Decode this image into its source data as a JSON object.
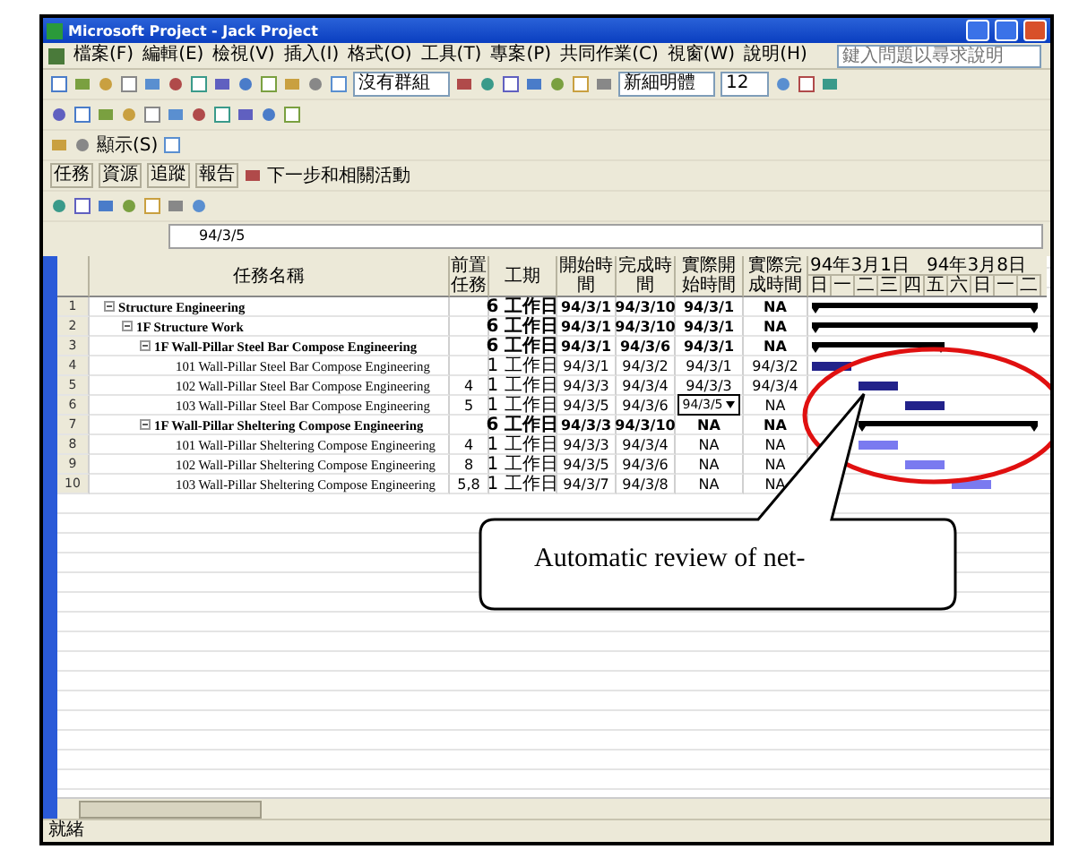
{
  "window": {
    "title": "Microsoft Project - Jack Project"
  },
  "menu": [
    {
      "label": "檔案(F)"
    },
    {
      "label": "編輯(E)"
    },
    {
      "label": "檢視(V)"
    },
    {
      "label": "插入(I)"
    },
    {
      "label": "格式(O)"
    },
    {
      "label": "工具(T)"
    },
    {
      "label": "專案(P)"
    },
    {
      "label": "共同作業(C)"
    },
    {
      "label": "視窗(W)"
    },
    {
      "label": "說明(H)"
    }
  ],
  "help_box": {
    "placeholder": "鍵入問題以尋求說明"
  },
  "toolbars": [
    {
      "items": [
        {
          "kind": "icon"
        },
        {
          "kind": "icon"
        },
        {
          "kind": "icon"
        },
        {
          "kind": "icon"
        },
        {
          "kind": "icon"
        },
        {
          "kind": "icon"
        },
        {
          "kind": "icon"
        },
        {
          "kind": "icon"
        },
        {
          "kind": "icon"
        },
        {
          "kind": "icon"
        },
        {
          "kind": "icon"
        },
        {
          "kind": "icon"
        },
        {
          "kind": "icon"
        },
        {
          "kind": "dropdown",
          "text": "沒有群組"
        },
        {
          "kind": "icon"
        },
        {
          "kind": "icon"
        },
        {
          "kind": "icon"
        },
        {
          "kind": "icon"
        },
        {
          "kind": "icon"
        },
        {
          "kind": "icon"
        },
        {
          "kind": "icon"
        },
        {
          "kind": "dropdown",
          "text": "新細明體"
        },
        {
          "kind": "dropdown",
          "text": "12"
        },
        {
          "kind": "icon"
        },
        {
          "kind": "icon"
        },
        {
          "kind": "icon"
        }
      ]
    },
    {
      "items": [
        {
          "kind": "icon"
        },
        {
          "kind": "icon"
        },
        {
          "kind": "icon"
        },
        {
          "kind": "icon"
        },
        {
          "kind": "icon"
        },
        {
          "kind": "icon"
        },
        {
          "kind": "icon"
        },
        {
          "kind": "icon"
        },
        {
          "kind": "icon"
        },
        {
          "kind": "icon"
        },
        {
          "kind": "icon"
        }
      ]
    },
    {
      "items": [
        {
          "kind": "icon"
        },
        {
          "kind": "icon"
        },
        {
          "kind": "text",
          "text": "顯示(S)"
        },
        {
          "kind": "icon"
        }
      ]
    },
    {
      "items": [
        {
          "kind": "tab",
          "text": "任務"
        },
        {
          "kind": "tab",
          "text": "資源"
        },
        {
          "kind": "tab",
          "text": "追蹤"
        },
        {
          "kind": "tab",
          "text": "報告"
        },
        {
          "kind": "icon"
        },
        {
          "kind": "text",
          "text": "下一步和相關活動"
        }
      ]
    },
    {
      "items": [
        {
          "kind": "icon"
        },
        {
          "kind": "icon"
        },
        {
          "kind": "icon"
        },
        {
          "kind": "icon"
        },
        {
          "kind": "icon"
        },
        {
          "kind": "icon"
        },
        {
          "kind": "icon"
        }
      ]
    }
  ],
  "entry_bar": {
    "value": "94/3/5"
  },
  "table": {
    "columns": [
      {
        "label": "任務名稱"
      },
      {
        "label": "前置任務"
      },
      {
        "label": "工期"
      },
      {
        "label": "開始時間"
      },
      {
        "label": "完成時間"
      },
      {
        "label": "實際開始時間"
      },
      {
        "label": "實際完成時間"
      }
    ],
    "rows": [
      {
        "id": "1",
        "name": "Structure Engineering",
        "duration": "6 工作日",
        "start": "94/3/1",
        "finish": "94/3/10",
        "actual_start": "94/3/1",
        "actual_finish": "NA",
        "summary": true,
        "expanded": true,
        "editing": false,
        "children": [
          {
            "id": "2",
            "name": "1F Structure Work",
            "duration": "6 工作日",
            "start": "94/3/1",
            "finish": "94/3/10",
            "actual_start": "94/3/1",
            "actual_finish": "NA",
            "summary": true,
            "expanded": true,
            "editing": false,
            "children": [
              {
                "id": "3",
                "name": "1F Wall-Pillar Steel Bar Compose Engineering",
                "duration": "6 工作日",
                "start": "94/3/1",
                "finish": "94/3/6",
                "actual_start": "94/3/1",
                "actual_finish": "NA",
                "summary": true,
                "expanded": true,
                "editing": false,
                "children": [
                  {
                    "id": "4",
                    "name": "101 Wall-Pillar Steel Bar Compose Engineering",
                    "duration": "1 工作日",
                    "start": "94/3/1",
                    "finish": "94/3/2",
                    "actual_start": "94/3/1",
                    "actual_finish": "94/3/2",
                    "summary": false,
                    "critical": true,
                    "editing": false
                  },
                  {
                    "id": "5",
                    "name": "102 Wall-Pillar Steel Bar Compose Engineering",
                    "predecessors": "4",
                    "duration": "1 工作日",
                    "start": "94/3/3",
                    "finish": "94/3/4",
                    "actual_start": "94/3/3",
                    "actual_finish": "94/3/4",
                    "summary": false,
                    "critical": true,
                    "editing": false
                  },
                  {
                    "id": "6",
                    "name": "103 Wall-Pillar Steel Bar Compose Engineering",
                    "predecessors": "5",
                    "duration": "1 工作日",
                    "start": "94/3/5",
                    "finish": "94/3/6",
                    "actual_start": "94/3/5",
                    "actual_finish": "NA",
                    "summary": false,
                    "critical": true,
                    "editing": true
                  }
                ]
              },
              {
                "id": "7",
                "name": "1F Wall-Pillar Sheltering Compose Engineering",
                "duration": "6 工作日",
                "start": "94/3/3",
                "finish": "94/3/10",
                "actual_start": "NA",
                "actual_finish": "NA",
                "summary": true,
                "expanded": true,
                "editing": false,
                "children": [
                  {
                    "id": "8",
                    "name": "101 Wall-Pillar Sheltering Compose Engineering",
                    "predecessors": "4",
                    "duration": "1 工作日",
                    "start": "94/3/3",
                    "finish": "94/3/4",
                    "actual_start": "NA",
                    "actual_finish": "NA",
                    "summary": false,
                    "critical": false,
                    "editing": false
                  },
                  {
                    "id": "9",
                    "name": "102 Wall-Pillar Sheltering Compose Engineering",
                    "predecessors": "8",
                    "duration": "1 工作日",
                    "start": "94/3/5",
                    "finish": "94/3/6",
                    "actual_start": "NA",
                    "actual_finish": "NA",
                    "summary": false,
                    "critical": false,
                    "editing": false
                  },
                  {
                    "id": "10",
                    "name": "103 Wall-Pillar Sheltering Compose Engineering",
                    "predecessors": "5,8",
                    "duration": "1 工作日",
                    "start": "94/3/7",
                    "finish": "94/3/8",
                    "actual_start": "NA",
                    "actual_finish": "NA",
                    "summary": false,
                    "critical": false,
                    "editing": false
                  }
                ]
              }
            ]
          }
        ]
      }
    ]
  },
  "timescale": {
    "major": [
      {
        "label": "94年3月1日"
      },
      {
        "label": "94年3月8日"
      }
    ],
    "minor": [
      {
        "label": "日"
      },
      {
        "label": "一"
      },
      {
        "label": "二"
      },
      {
        "label": "三"
      },
      {
        "label": "四"
      },
      {
        "label": "五"
      },
      {
        "label": "六"
      },
      {
        "label": "日"
      },
      {
        "label": "一"
      },
      {
        "label": "二"
      }
    ]
  },
  "status_bar": {
    "text": "就緒"
  },
  "callout": {
    "text": "Automatic review of net-"
  }
}
